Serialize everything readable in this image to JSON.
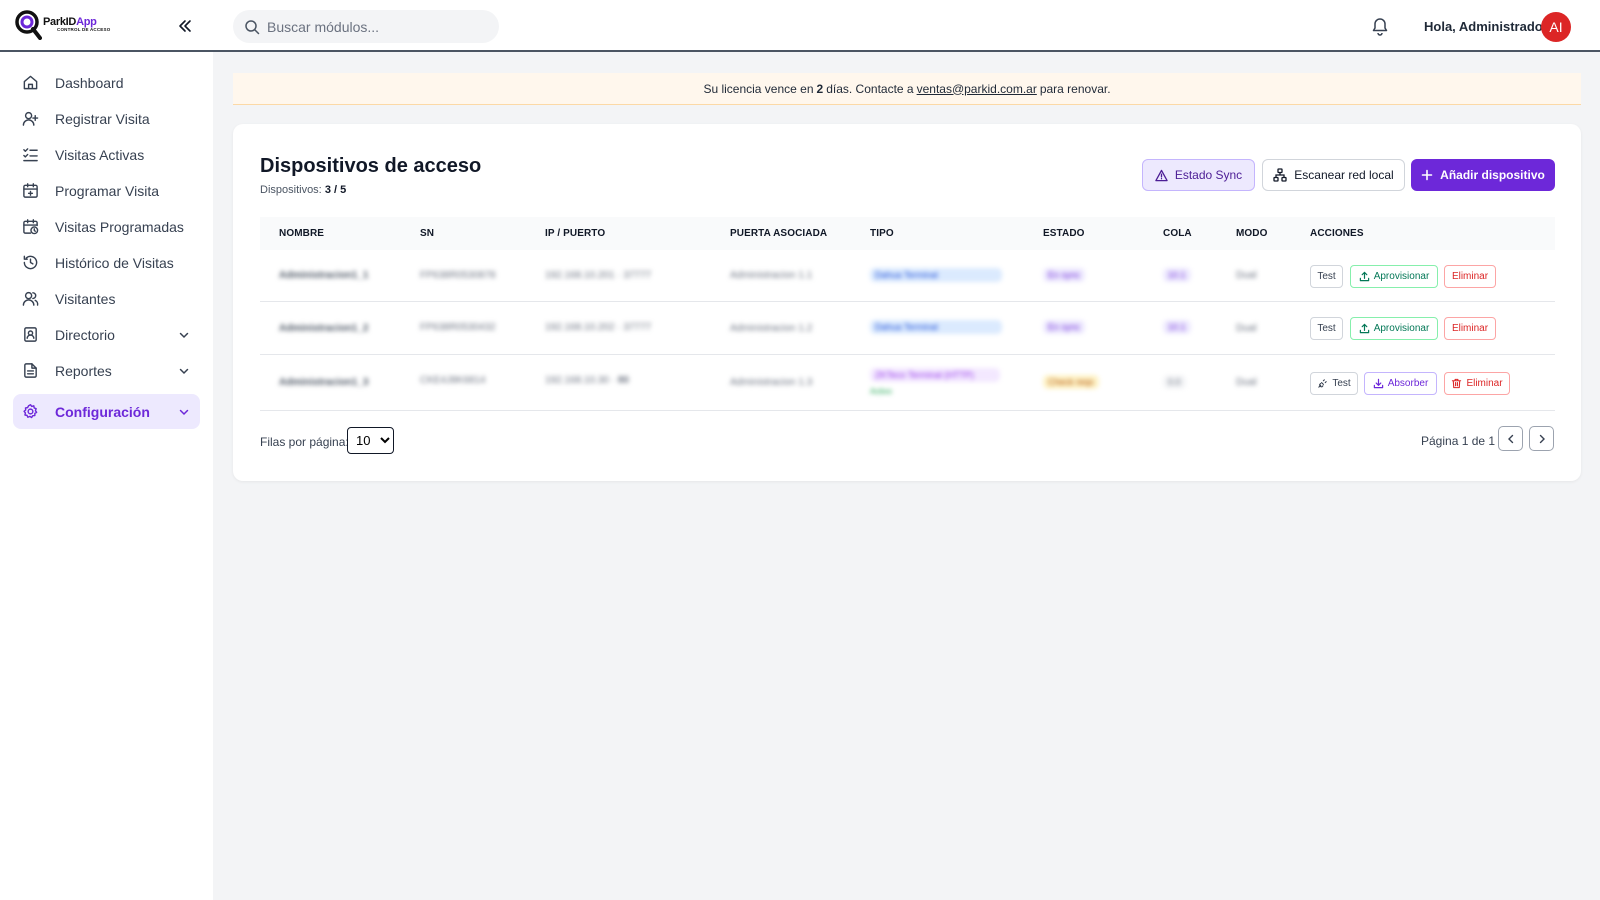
{
  "app": {
    "logo_text_1": "Park",
    "logo_text_2": "ID",
    "logo_text_3": "App",
    "logo_tagline": "CONTROL DE ACCESO"
  },
  "header": {
    "search_placeholder": "Buscar módulos...",
    "greeting": "Hola, Administrador",
    "avatar_initials": "AI"
  },
  "sidebar": {
    "items": [
      {
        "label": "Dashboard",
        "icon": "home-icon"
      },
      {
        "label": "Registrar Visita",
        "icon": "user-plus-icon"
      },
      {
        "label": "Visitas Activas",
        "icon": "list-checks-icon"
      },
      {
        "label": "Programar Visita",
        "icon": "calendar-plus-icon"
      },
      {
        "label": "Visitas Programadas",
        "icon": "calendar-clock-icon"
      },
      {
        "label": "Histórico de Visitas",
        "icon": "history-icon"
      },
      {
        "label": "Visitantes",
        "icon": "users-icon"
      },
      {
        "label": "Directorio",
        "icon": "contact-book-icon"
      },
      {
        "label": "Reportes",
        "icon": "file-text-icon"
      },
      {
        "label": "Configuración",
        "icon": "gear-icon"
      }
    ]
  },
  "banner": {
    "text_before": "Su licencia vence en",
    "days": "2",
    "text_mid": "días. Contacte a",
    "email": "ventas@parkid.com.ar",
    "text_after": "para renovar."
  },
  "card": {
    "title": "Dispositivos de acceso",
    "subtitle_label": "Dispositivos:",
    "subtitle_value": "3 / 5",
    "btn_sync": "Estado Sync",
    "btn_scan": "Escanear red local",
    "btn_add": "Añadir dispositivo"
  },
  "table": {
    "headers": [
      "NOMBRE",
      "SN",
      "IP / PUERTO",
      "PUERTA ASOCIADA",
      "TIPO",
      "ESTADO",
      "COLA",
      "MODO",
      "ACCIONES"
    ],
    "rows": [
      {
        "nombre": "Administracion1_1",
        "sn": "FP638R0530878",
        "ip": "192.168.10.201",
        "port": "37777",
        "puerta": "Administracion 1.1",
        "tipo": "Dahua Terminal",
        "estado": "En sync",
        "cola": "10.1",
        "modo": "Dual",
        "actions": [
          "Test",
          "Aprovisionar",
          "Eliminar"
        ]
      },
      {
        "nombre": "Administracion1_2",
        "sn": "FP638R0530432",
        "ip": "192.168.10.202",
        "port": "37777",
        "puerta": "Administracion 1.2",
        "tipo": "Dahua Terminal",
        "estado": "En sync",
        "cola": "10.1",
        "modo": "Dual",
        "actions": [
          "Test",
          "Aprovisionar",
          "Eliminar"
        ]
      },
      {
        "nombre": "Administracion1_3",
        "sn": "CKE4J8K6814",
        "ip": "192.168.10.30",
        "port": "80",
        "puerta": "Administracion 1.3",
        "tipo": "ZKTeco Terminal (HTTP)",
        "tipo_sub": "Activo",
        "estado": "Check reqs",
        "cola": "0.0",
        "modo": "Dual",
        "actions": [
          "Test",
          "Absorber",
          "Eliminar"
        ]
      }
    ]
  },
  "pagination": {
    "rows_per_page_label": "Filas por página:",
    "rows_per_page_value": "10",
    "rows_per_page_options": [
      "10"
    ],
    "page_info": "Página 1 de 1"
  },
  "colors": {
    "accent": "#6d28d9",
    "danger": "#dc2626",
    "success": "#047857",
    "banner_bg": "#fff7ed"
  }
}
